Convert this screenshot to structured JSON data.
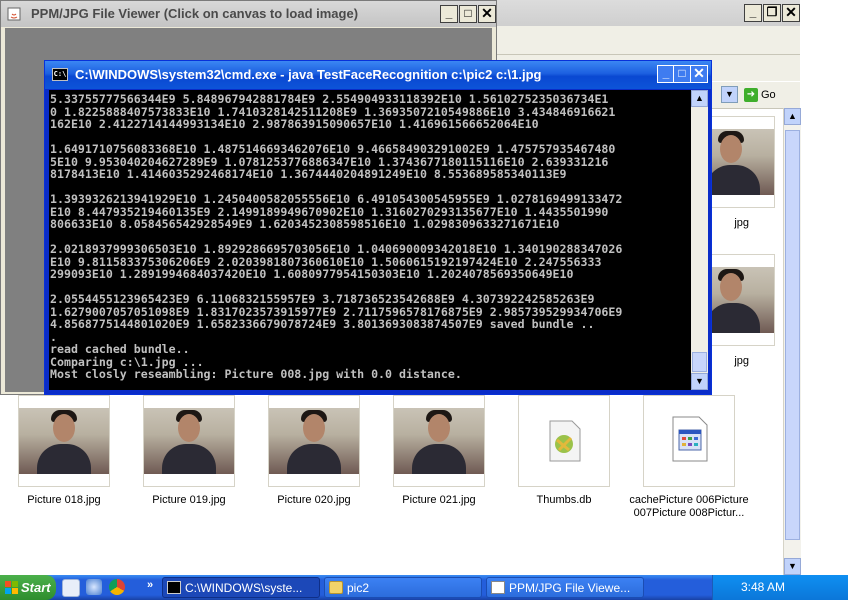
{
  "explorer": {
    "go_label": "Go",
    "items": [
      {
        "label": "Picture 018.jpg",
        "type": "image"
      },
      {
        "label": "Picture 019.jpg",
        "type": "image"
      },
      {
        "label": "Picture 020.jpg",
        "type": "image"
      },
      {
        "label": "Picture 021.jpg",
        "type": "image"
      },
      {
        "label": "Thumbs.db",
        "type": "db-file"
      },
      {
        "label": "cachePicture 006Picture 007Picture 008Pictur...",
        "type": "file"
      }
    ],
    "partial_labels": [
      "jpg",
      "jpg"
    ]
  },
  "viewer": {
    "title": "PPM/JPG File Viewer (Click on canvas to load image)"
  },
  "cmd": {
    "title": "C:\\WINDOWS\\system32\\cmd.exe - java TestFaceRecognition c:\\pic2 c:\\1.jpg",
    "output": "5.33755777566344E9 5.848967942881784E9 2.554904933118392E10 1.5610275235036734E1\n0 1.8225888407573833E10 1.7410328142511208E9 1.3693507210549886E10 3.434846916621\n162E10 2.4122714144993134E10 2.987863915090657E10 1.416961566652064E10\n\n1.6491710756083368E10 1.4875146693462076E10 9.466584903291002E9 1.475757935467480\n5E10 9.953040204627289E9 1.0781253776886347E10 1.3743677180115116E10 2.639331216\n8178413E10 1.4146035292468174E10 1.3674440204891249E10 8.553689585340113E9\n\n1.3939326213941929E10 1.2450400582055556E10 6.491054300545955E9 1.0278169499133472\nE10 8.447935219460135E9 2.1499189949670902E10 1.3160270293135677E10 1.4435501990\n806633E10 8.058456542928549E9 1.6203452308598516E10 1.0298309633271671E10\n\n2.0218937999306503E10 1.8929286695703056E10 1.040690009342018E10 1.340190288347026\nE10 9.811583375306206E9 2.0203981807360610E10 1.5060615192197424E10 2.247556333\n299093E10 1.2891994684037420E10 1.6080977954150303E10 1.2024078569350649E10\n\n2.0554455123965423E9 6.1106832155957E9 3.718736523542688E9 4.307392242585263E9\n1.6279007057051098E9 1.8317023573915977E9 2.7117596578176875E9 2.985739529934706E9\n4.8568775144801020E9 1.6582336679078724E9 3.8013693083874507E9 saved bundle ..\n.\nread cached bundle..\nComparing c:\\1.jpg ...\nMost closly reseambling: Picture 008.jpg with 0.0 distance.\n_"
  },
  "taskbar": {
    "start_label": "Start",
    "tasks": [
      {
        "label": "C:\\WINDOWS\\syste...",
        "icon": "cmd-icon",
        "active": true
      },
      {
        "label": "pic2",
        "icon": "folder-icon",
        "active": false
      },
      {
        "label": "PPM/JPG File Viewe...",
        "icon": "java-app-icon",
        "active": false
      }
    ],
    "clock": "3:48 AM"
  },
  "colors": {
    "xp_title_blue": "#0a48d2",
    "taskbar_blue": "#245edb",
    "console_bg": "#000000",
    "console_fg": "#c0c0c0",
    "start_green": "#2e8d2e"
  }
}
